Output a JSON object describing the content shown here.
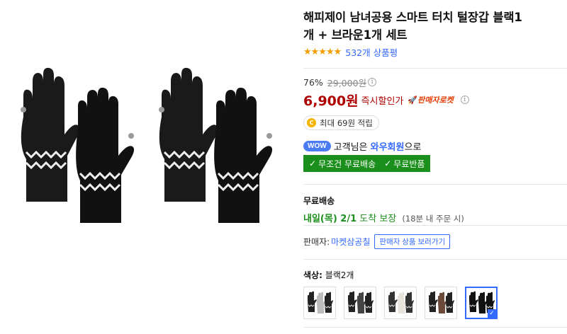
{
  "product": {
    "title_line1": "해피제이 남녀공용 스마트 터치 털장갑 블랙1",
    "title_line2": "개 + 브라운1개 세트",
    "stars": "★★★★★",
    "rating": 4.5,
    "review_count_text": "532개 상품평"
  },
  "price": {
    "discount_rate": "76%",
    "original_price": "29,000원",
    "sale_price": "6,900원",
    "instant_discount_label": "즉시할인가",
    "rocket_label": "판매자로켓",
    "info_glyph": "i"
  },
  "points": {
    "coin_glyph": "C",
    "text": "최대 69원 적립"
  },
  "wow": {
    "badge": "WOW",
    "prefix": "고객님은",
    "member": "와우회원",
    "suffix": "으로"
  },
  "benefits": {
    "free_shipping": "무조건 무료배송",
    "free_return": "무료반품",
    "check_glyph": "✓"
  },
  "shipping": {
    "title": "무료배송",
    "date": "내일(목) 2/1",
    "guarantee": "도착 보장",
    "condition": "(18분 내 주문 시)"
  },
  "seller": {
    "label": "판매자:",
    "name": "마켓삼공칠",
    "button": "판매자 상품 보러가기"
  },
  "option": {
    "label": "색상:",
    "value": "블랙2개",
    "thumbs": [
      {
        "name": "gray-white",
        "colors": [
          "#222",
          "#bbb"
        ]
      },
      {
        "name": "black-gray",
        "colors": [
          "#222",
          "#444"
        ]
      },
      {
        "name": "gray-cream",
        "colors": [
          "#333",
          "#e8e4dc"
        ]
      },
      {
        "name": "black-brown",
        "colors": [
          "#222",
          "#6b4a3a"
        ]
      },
      {
        "name": "black-black",
        "colors": [
          "#111",
          "#111"
        ]
      }
    ],
    "selected_index": 4,
    "tick_glyph": "✓"
  },
  "colors": {
    "accent_blue": "#346aff",
    "price_red": "#ae0000",
    "benefit_green": "#1b8f1b",
    "star_orange": "#f59c00"
  }
}
